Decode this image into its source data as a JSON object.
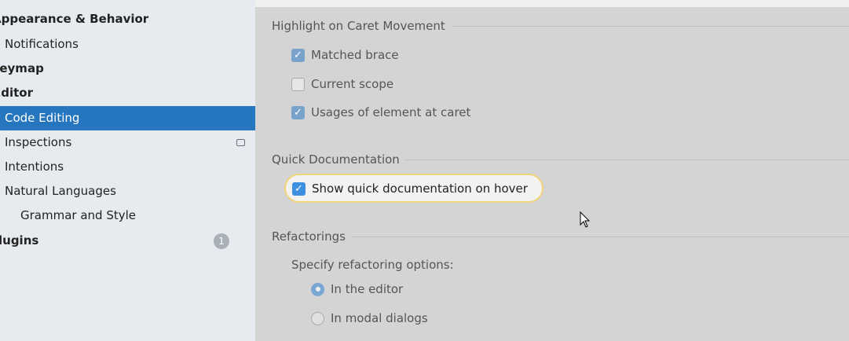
{
  "sidebar": {
    "items": [
      {
        "label": "Appearance & Behavior"
      },
      {
        "label": "Notifications"
      },
      {
        "label": "Keymap"
      },
      {
        "label": "Editor"
      },
      {
        "label": "Code Editing"
      },
      {
        "label": "Inspections"
      },
      {
        "label": "Intentions"
      },
      {
        "label": "Natural Languages"
      },
      {
        "label": "Grammar and Style"
      },
      {
        "label": "Plugins",
        "badge": "1"
      }
    ]
  },
  "main": {
    "caret": {
      "title": "Highlight on Caret Movement",
      "options": [
        {
          "label": "Matched brace",
          "checked": true
        },
        {
          "label": "Current scope",
          "checked": false
        },
        {
          "label": "Usages of element at caret",
          "checked": true
        }
      ]
    },
    "quickdoc": {
      "title": "Quick Documentation",
      "option": {
        "label": "Show quick documentation on hover",
        "checked": true
      }
    },
    "refactor": {
      "title": "Refactorings",
      "subtitle": "Specify refactoring options:",
      "options": [
        {
          "label": "In the editor",
          "selected": true
        },
        {
          "label": "In modal dialogs",
          "selected": false
        }
      ]
    }
  }
}
